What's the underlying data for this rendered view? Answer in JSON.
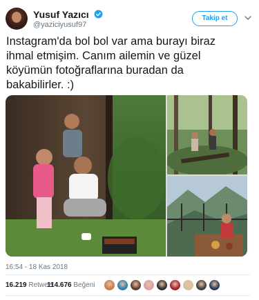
{
  "author": {
    "name": "Yusuf Yazıcı",
    "handle": "@yaziciyusuf97",
    "verified": true
  },
  "actions": {
    "follow_label": "Takip et",
    "more_icon": "chevron-down-icon"
  },
  "tweet": {
    "text": "Instagram'da bol bol var ama burayı biraz\nihmal etmişim. Canım ailemin ve güzel\nköyümün fotoğraflarına buradan da\nbakabilirler. :)",
    "timestamp": "16:54 - 18 Kas 2018"
  },
  "stats": {
    "retweets_count": "16.219",
    "retweets_label": "Retweet",
    "likes_count": "114.676",
    "likes_label": "Beğeni"
  },
  "likers": [
    {
      "color": "#c97a4a"
    },
    {
      "color": "#2a7fa8"
    },
    {
      "color": "#5a3a2e"
    },
    {
      "color": "#d9a0a8"
    },
    {
      "color": "#2b2b2b"
    },
    {
      "color": "#a02030"
    },
    {
      "color": "#d4c3a0"
    },
    {
      "color": "#3d3d3d"
    },
    {
      "color": "#1f3a5a"
    }
  ],
  "colors": {
    "accent": "#1da1f2",
    "text": "#14171a",
    "muted": "#657786"
  }
}
